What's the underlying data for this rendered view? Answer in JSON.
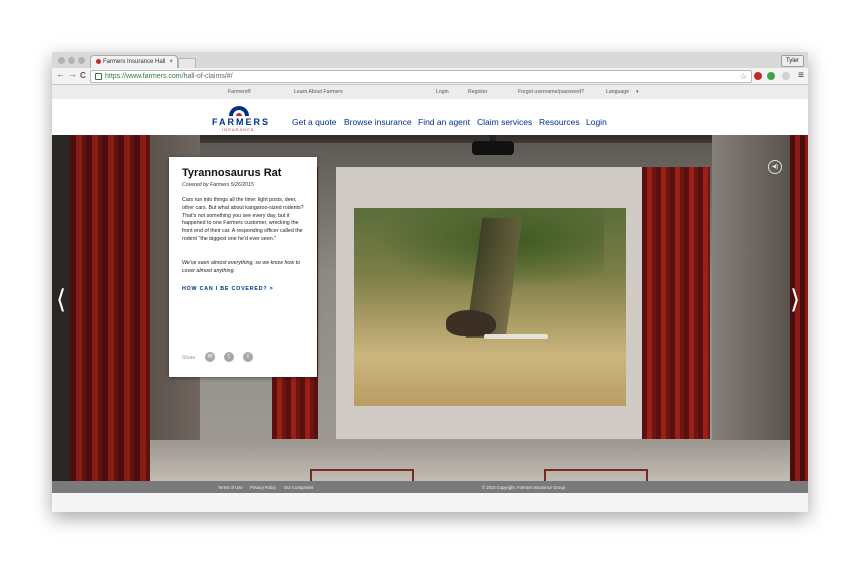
{
  "browser": {
    "tab_title": "Farmers Insurance Hall",
    "tab_close": "×",
    "user_name": "Tyler",
    "url_host": "https://www.farmers.com",
    "url_path": "/hall-of-claims/#/",
    "back": "←",
    "forward": "→",
    "reload": "C",
    "star": "☆",
    "menu": "≡"
  },
  "utility_nav": {
    "brand": "Farmers®",
    "learn": "Learn About Farmers",
    "login": "Login",
    "register": "Register",
    "forgot": "Forgot username/password?",
    "language": "Language"
  },
  "logo": {
    "word": "FARMERS",
    "sub": "INSURANCE"
  },
  "main_nav": {
    "items": [
      "Get a quote",
      "Browse insurance",
      "Find an agent",
      "Claim services",
      "Resources",
      "Login"
    ]
  },
  "stage": {
    "prev": "⟨",
    "next": "⟩",
    "sound": "◀)"
  },
  "card": {
    "title": "Tyrannosaurus Rat",
    "subtitle": "Covered by Farmers 5/26/2015",
    "body": "Cars run into things all the time: light posts, deer, other cars. But what about kangaroo-sized rodents? That's not something you see every day, but it happened to one Farmers customer, wrecking the front end of their car. A responding officer called the rodent \"the biggest one he'd ever seen.\"",
    "tagline": "We've seen almost everything, so we know how to cover almost anything.",
    "cta": "HOW CAN I BE COVERED?  >",
    "share_label": "Share"
  },
  "footer": {
    "terms": "Terms of Use",
    "privacy": "Privacy Policy",
    "companies": "Our Companies",
    "copyright": "© 2015 Copyright, Farmers Insurance Group"
  },
  "colors": {
    "brand_blue": "#003087",
    "brand_red": "#c62828",
    "curtain_red": "#8a1c16"
  }
}
